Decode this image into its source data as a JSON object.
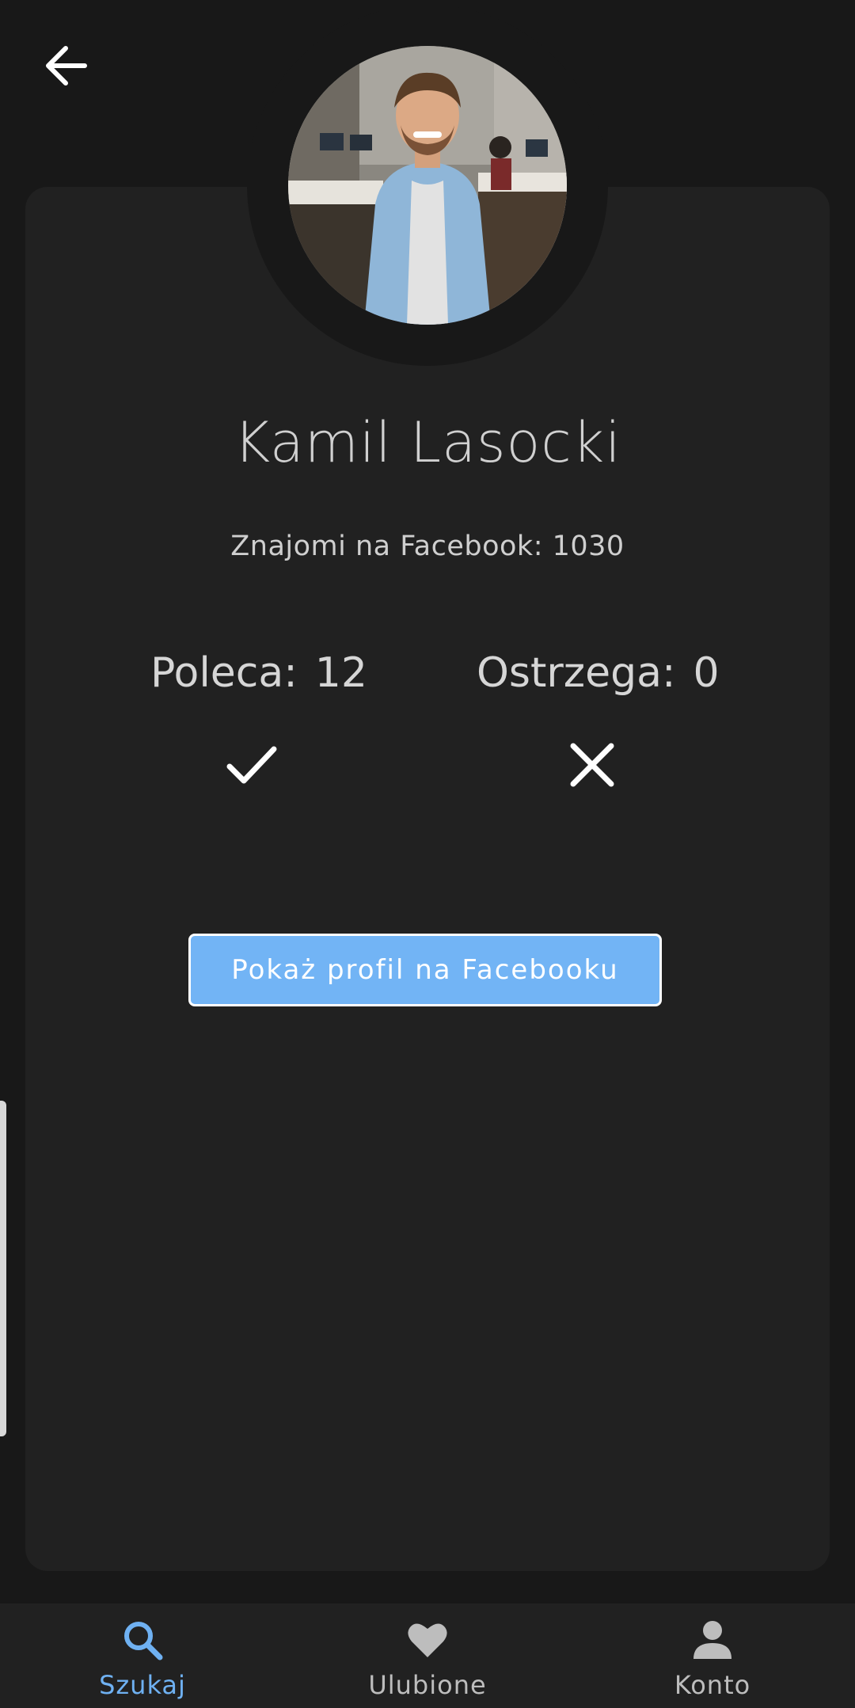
{
  "profile": {
    "name": "Kamil Lasocki",
    "friends_text": "Znajomi na Facebook: 1030"
  },
  "stats": {
    "recommends_label": "Poleca:",
    "recommends_value": "12",
    "warns_label": "Ostrzega:",
    "warns_value": "0"
  },
  "actions": {
    "facebook_button": "Pokaż profil na Facebooku"
  },
  "nav": {
    "items": [
      {
        "label": "Szukaj",
        "icon": "search-icon",
        "active": true
      },
      {
        "label": "Ulubione",
        "icon": "heart-icon",
        "active": false
      },
      {
        "label": "Konto",
        "icon": "person-icon",
        "active": false
      }
    ]
  },
  "colors": {
    "background": "#181818",
    "card": "#212121",
    "accent": "#72b4f5",
    "active_nav": "#6fb1f2"
  }
}
